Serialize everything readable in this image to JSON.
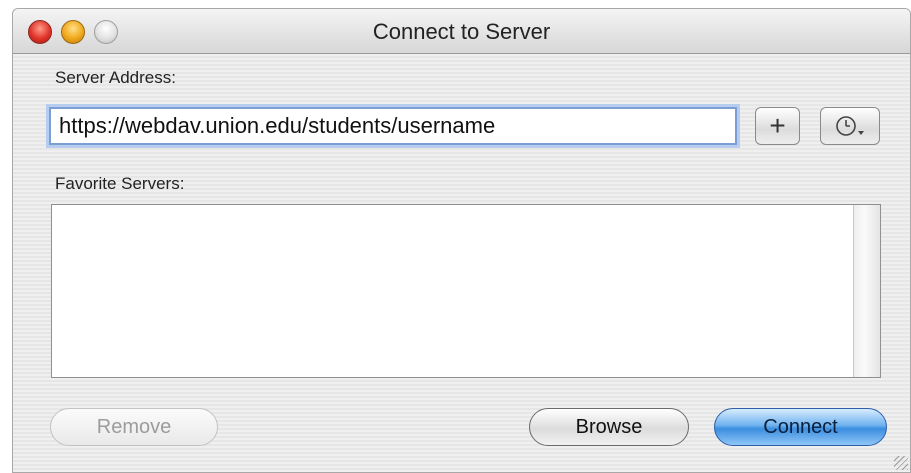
{
  "window": {
    "title": "Connect to Server"
  },
  "server_address": {
    "label": "Server Address:",
    "value": "https://webdav.union.edu/students/username"
  },
  "favorites": {
    "label": "Favorite Servers:",
    "items": []
  },
  "buttons": {
    "add_label": "+",
    "remove_label": "Remove",
    "browse_label": "Browse",
    "connect_label": "Connect"
  },
  "icons": {
    "close": "close-icon",
    "minimize": "minimize-icon",
    "zoom": "zoom-icon",
    "recent": "clock-icon"
  },
  "colors": {
    "accent": "#3b8ee0",
    "focus_ring": "#7b9fd4"
  }
}
